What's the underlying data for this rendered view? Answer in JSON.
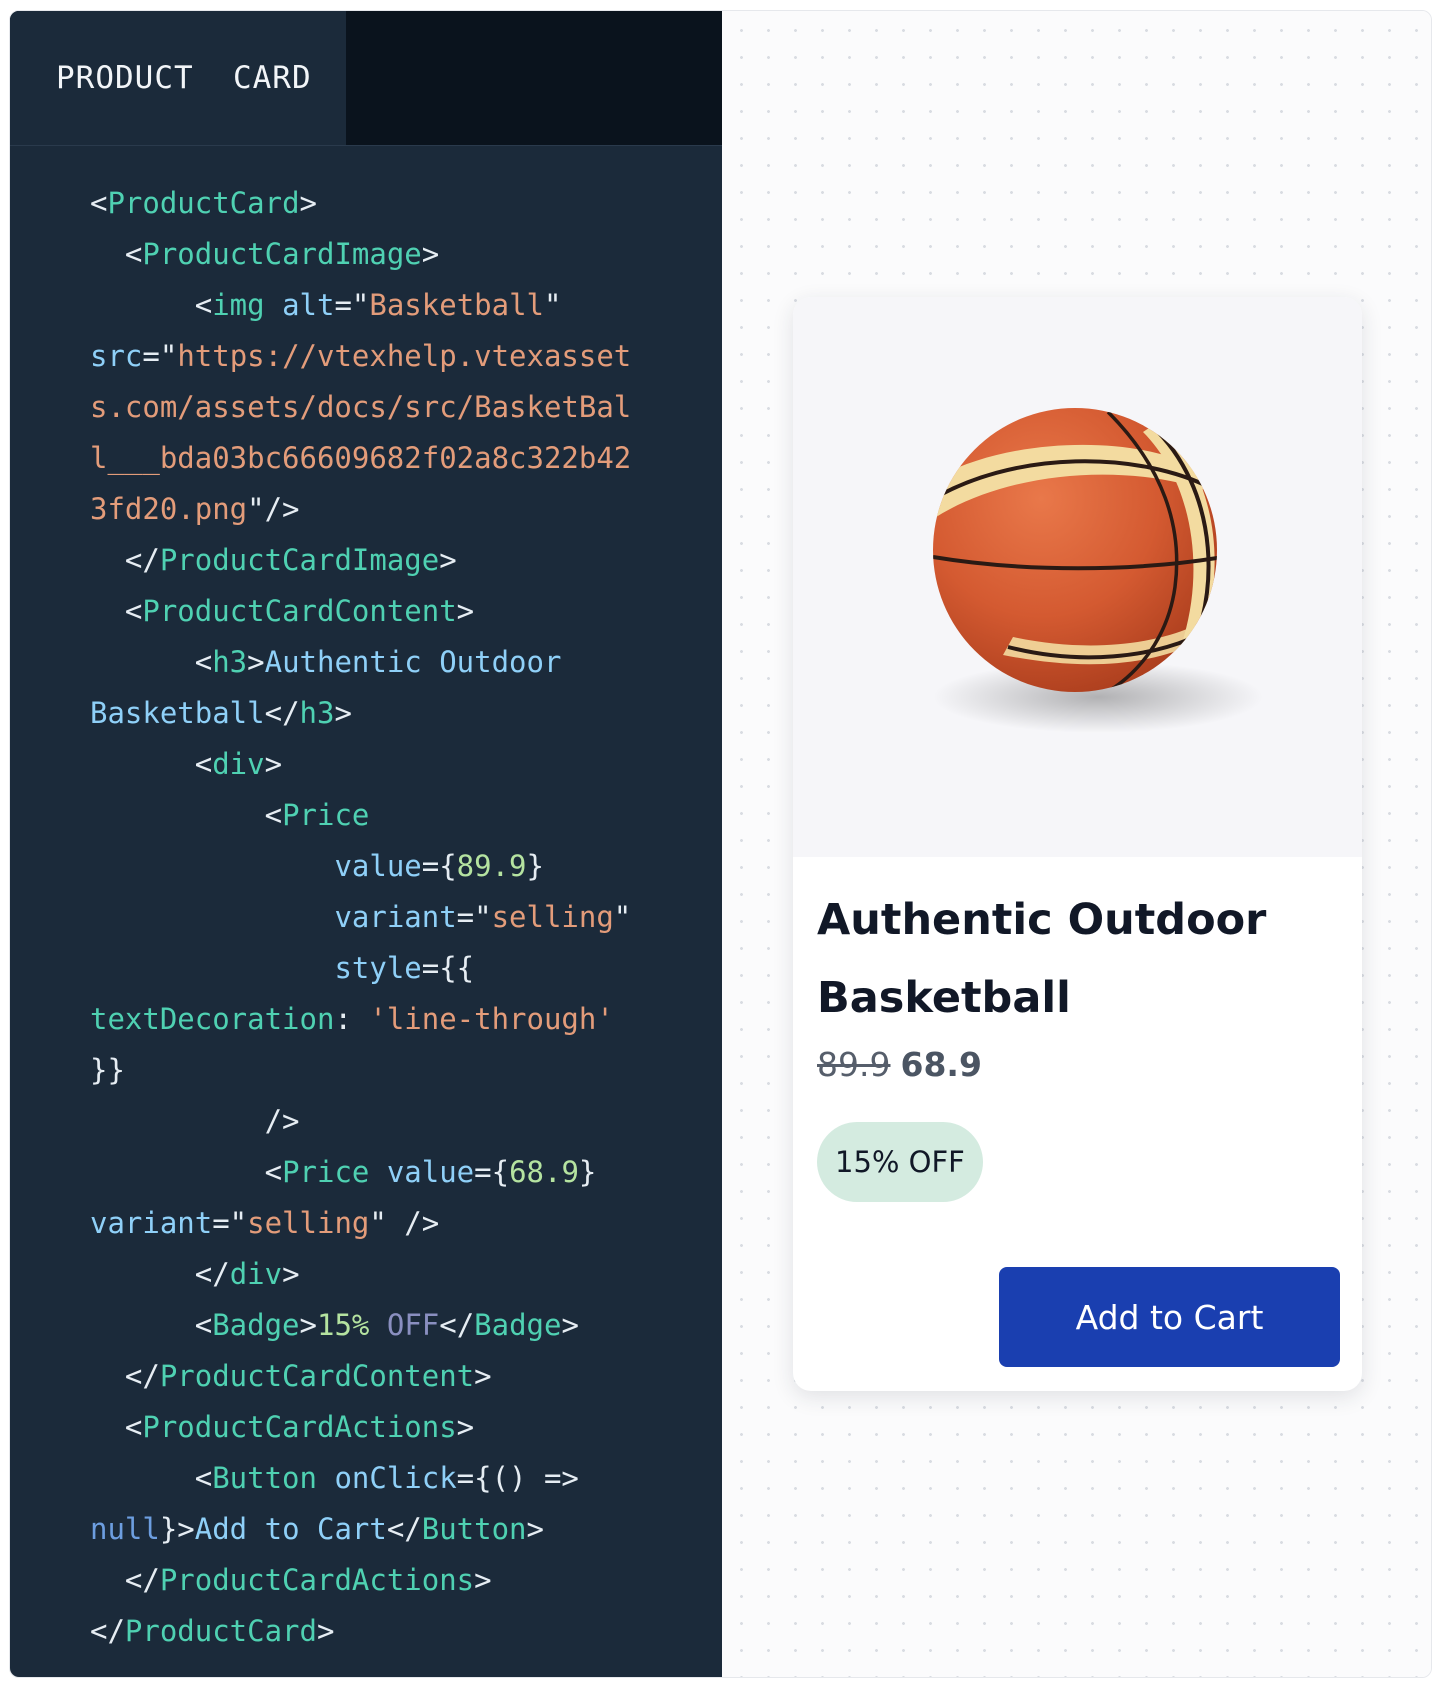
{
  "tab": {
    "label": "PRODUCT  CARD"
  },
  "code": {
    "lines": [
      [
        [
          "p",
          "<"
        ],
        [
          "tag",
          "ProductCard"
        ],
        [
          "p",
          ">"
        ]
      ],
      [
        [
          "p",
          "  <"
        ],
        [
          "tag",
          "ProductCardImage"
        ],
        [
          "p",
          ">"
        ]
      ],
      [
        [
          "p",
          "      <"
        ],
        [
          "tag",
          "img"
        ],
        [
          "p",
          " "
        ],
        [
          "attr",
          "alt"
        ],
        [
          "p",
          "=\""
        ],
        [
          "str",
          "Basketball"
        ],
        [
          "p",
          "\""
        ]
      ],
      [
        [
          "attr",
          "src"
        ],
        [
          "p",
          "=\""
        ],
        [
          "str",
          "https://vtexhelp.vtexasset"
        ]
      ],
      [
        [
          "str",
          "s.com/assets/docs/src/BasketBal"
        ]
      ],
      [
        [
          "str",
          "l___bda03bc66609682f02a8c322b42"
        ]
      ],
      [
        [
          "str",
          "3fd20.png"
        ],
        [
          "p",
          "\"/>"
        ]
      ],
      [
        [
          "p",
          "  </"
        ],
        [
          "tag",
          "ProductCardImage"
        ],
        [
          "p",
          ">"
        ]
      ],
      [
        [
          "p",
          "  <"
        ],
        [
          "tag",
          "ProductCardContent"
        ],
        [
          "p",
          ">"
        ]
      ],
      [
        [
          "p",
          "      <"
        ],
        [
          "tag",
          "h3"
        ],
        [
          "p",
          ">"
        ],
        [
          "txt",
          "Authentic Outdoor"
        ]
      ],
      [
        [
          "txt",
          "Basketball"
        ],
        [
          "p",
          "</"
        ],
        [
          "tag",
          "h3"
        ],
        [
          "p",
          ">"
        ]
      ],
      [
        [
          "p",
          "      <"
        ],
        [
          "tag",
          "div"
        ],
        [
          "p",
          ">"
        ]
      ],
      [
        [
          "p",
          "          <"
        ],
        [
          "tag",
          "Price"
        ]
      ],
      [
        [
          "p",
          "              "
        ],
        [
          "attr",
          "value"
        ],
        [
          "p",
          "={"
        ],
        [
          "num",
          "89.9"
        ],
        [
          "p",
          "}"
        ]
      ],
      [
        [
          "p",
          "              "
        ],
        [
          "attr",
          "variant"
        ],
        [
          "p",
          "=\""
        ],
        [
          "str",
          "selling"
        ],
        [
          "p",
          "\""
        ]
      ],
      [
        [
          "p",
          "              "
        ],
        [
          "attr",
          "style"
        ],
        [
          "p",
          "={{"
        ]
      ],
      [
        [
          "tag",
          "textDecoration"
        ],
        [
          "p",
          ": "
        ],
        [
          "str",
          "'line-through'"
        ]
      ],
      [
        [
          "p",
          "}}"
        ]
      ],
      [
        [
          "p",
          "          />"
        ]
      ],
      [
        [
          "p",
          "          <"
        ],
        [
          "tag",
          "Price"
        ],
        [
          "p",
          " "
        ],
        [
          "attr",
          "value"
        ],
        [
          "p",
          "={"
        ],
        [
          "num",
          "68.9"
        ],
        [
          "p",
          "}"
        ]
      ],
      [
        [
          "attr",
          "variant"
        ],
        [
          "p",
          "=\""
        ],
        [
          "str",
          "selling"
        ],
        [
          "p",
          "\" />"
        ]
      ],
      [
        [
          "p",
          "      </"
        ],
        [
          "tag",
          "div"
        ],
        [
          "p",
          ">"
        ]
      ],
      [
        [
          "p",
          "      <"
        ],
        [
          "tag",
          "Badge"
        ],
        [
          "p",
          ">"
        ],
        [
          "num",
          "15%"
        ],
        [
          "p",
          " "
        ],
        [
          "dim",
          "OFF"
        ],
        [
          "p",
          "</"
        ],
        [
          "tag",
          "Badge"
        ],
        [
          "p",
          ">"
        ]
      ],
      [
        [
          "p",
          "  </"
        ],
        [
          "tag",
          "ProductCardContent"
        ],
        [
          "p",
          ">"
        ]
      ],
      [
        [
          "p",
          "  <"
        ],
        [
          "tag",
          "ProductCardActions"
        ],
        [
          "p",
          ">"
        ]
      ],
      [
        [
          "p",
          "      <"
        ],
        [
          "tag",
          "Button"
        ],
        [
          "p",
          " "
        ],
        [
          "attr",
          "onClick"
        ],
        [
          "p",
          "={() =>"
        ]
      ],
      [
        [
          "kw",
          "null"
        ],
        [
          "p",
          "}>"
        ],
        [
          "txt",
          "Add to Cart"
        ],
        [
          "p",
          "</"
        ],
        [
          "tag",
          "Button"
        ],
        [
          "p",
          ">"
        ]
      ],
      [
        [
          "p",
          "  </"
        ],
        [
          "tag",
          "ProductCardActions"
        ],
        [
          "p",
          ">"
        ]
      ],
      [
        [
          "p",
          "</"
        ],
        [
          "tag",
          "ProductCard"
        ],
        [
          "p",
          ">"
        ]
      ]
    ]
  },
  "product": {
    "image_alt": "Basketball",
    "title": "Authentic Outdoor Basketball",
    "price_old": "89.9",
    "price_new": "68.9",
    "badge": "15% OFF",
    "button_label": "Add to Cart"
  },
  "colors": {
    "code_bg": "#1b2a3a",
    "tab_strip_bg": "#0a131d",
    "badge_bg": "#d4ebe0",
    "button_bg": "#1a3fb0",
    "ball_orange": "#d9623a",
    "ball_stripe": "#f3dba0"
  }
}
